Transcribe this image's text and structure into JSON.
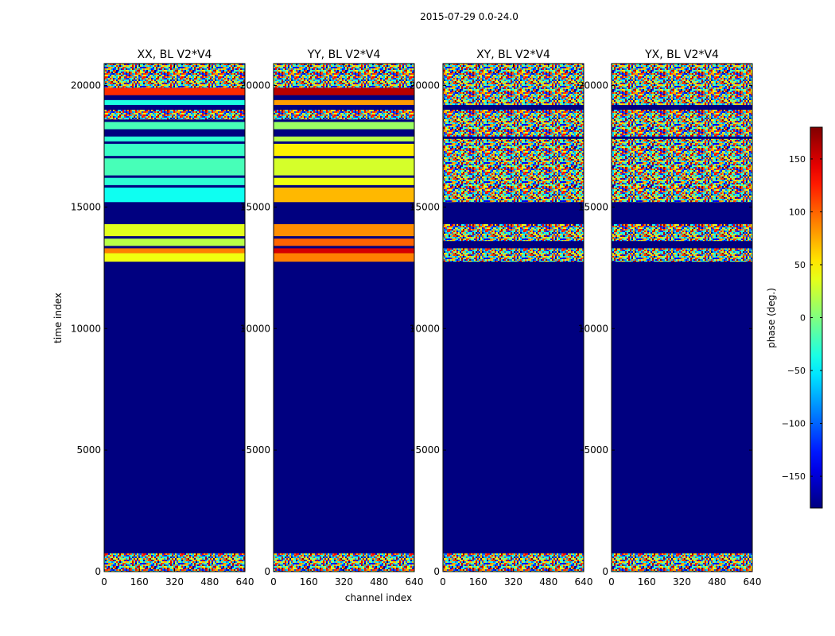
{
  "suptitle": "2015-07-29 0.0-24.0",
  "chart_data": {
    "type": "heatmap",
    "xlabel": "channel index",
    "ylabel": "time index",
    "xlim": [
      0,
      640
    ],
    "ylim": [
      0,
      20900
    ],
    "xticks": [
      0,
      160,
      320,
      480,
      640
    ],
    "yticks": [
      0,
      5000,
      10000,
      15000,
      20000
    ],
    "colorbar": {
      "label": "phase (deg.)",
      "range": [
        -180,
        180
      ],
      "ticks": [
        150,
        100,
        50,
        0,
        -50,
        -100,
        -150
      ],
      "colormap": "jet"
    },
    "panels": [
      {
        "title": "XX, BL V2*V4",
        "bands": [
          {
            "t0": 0,
            "t1": 750,
            "phase": "noise"
          },
          {
            "t0": 750,
            "t1": 12750,
            "phase": -180
          },
          {
            "t0": 12750,
            "t1": 13100,
            "phase": 40
          },
          {
            "t0": 13100,
            "t1": 13300,
            "phase": 90
          },
          {
            "t0": 13400,
            "t1": 13700,
            "phase": 20
          },
          {
            "t0": 13800,
            "t1": 14300,
            "phase": 35
          },
          {
            "t0": 14300,
            "t1": 15100,
            "phase": -180
          },
          {
            "t0": 15200,
            "t1": 15800,
            "phase": -40
          },
          {
            "t0": 15900,
            "t1": 16200,
            "phase": -30
          },
          {
            "t0": 16300,
            "t1": 17000,
            "phase": -20
          },
          {
            "t0": 17100,
            "t1": 17600,
            "phase": -25
          },
          {
            "t0": 17700,
            "t1": 17900,
            "phase": -30
          },
          {
            "t0": 18200,
            "t1": 18500,
            "phase": -20
          },
          {
            "t0": 18600,
            "t1": 19000,
            "phase": "noise"
          },
          {
            "t0": 19200,
            "t1": 19400,
            "phase": -35
          },
          {
            "t0": 19600,
            "t1": 19900,
            "phase": 120
          },
          {
            "t0": 19900,
            "t1": 20900,
            "phase": "noise"
          }
        ]
      },
      {
        "title": "YY, BL V2*V4",
        "bands": [
          {
            "t0": 0,
            "t1": 750,
            "phase": "noise"
          },
          {
            "t0": 750,
            "t1": 12750,
            "phase": -180
          },
          {
            "t0": 12750,
            "t1": 13100,
            "phase": 90
          },
          {
            "t0": 13100,
            "t1": 13300,
            "phase": 150
          },
          {
            "t0": 13400,
            "t1": 13700,
            "phase": 100
          },
          {
            "t0": 13800,
            "t1": 14300,
            "phase": 85
          },
          {
            "t0": 14300,
            "t1": 15100,
            "phase": -180
          },
          {
            "t0": 15200,
            "t1": 15800,
            "phase": 70
          },
          {
            "t0": 15900,
            "t1": 16200,
            "phase": 40
          },
          {
            "t0": 16300,
            "t1": 17000,
            "phase": 30
          },
          {
            "t0": 17100,
            "t1": 17600,
            "phase": 50
          },
          {
            "t0": 17700,
            "t1": 17900,
            "phase": 20
          },
          {
            "t0": 18200,
            "t1": 18500,
            "phase": 10
          },
          {
            "t0": 18600,
            "t1": 19000,
            "phase": "noise"
          },
          {
            "t0": 19200,
            "t1": 19400,
            "phase": 80
          },
          {
            "t0": 19600,
            "t1": 19900,
            "phase": 160
          },
          {
            "t0": 19900,
            "t1": 20900,
            "phase": "noise"
          }
        ]
      },
      {
        "title": "XY, BL V2*V4",
        "bands": [
          {
            "t0": 0,
            "t1": 750,
            "phase": "noise"
          },
          {
            "t0": 750,
            "t1": 12750,
            "phase": -180
          },
          {
            "t0": 12750,
            "t1": 13300,
            "phase": "noise"
          },
          {
            "t0": 13600,
            "t1": 14300,
            "phase": "noise"
          },
          {
            "t0": 14300,
            "t1": 15100,
            "phase": -180
          },
          {
            "t0": 15200,
            "t1": 17800,
            "phase": "noise"
          },
          {
            "t0": 17900,
            "t1": 19000,
            "phase": "noise"
          },
          {
            "t0": 19200,
            "t1": 20900,
            "phase": "noise"
          }
        ]
      },
      {
        "title": "YX, BL V2*V4",
        "bands": [
          {
            "t0": 0,
            "t1": 750,
            "phase": "noise"
          },
          {
            "t0": 750,
            "t1": 12750,
            "phase": -180
          },
          {
            "t0": 12750,
            "t1": 13300,
            "phase": "noise"
          },
          {
            "t0": 13600,
            "t1": 14300,
            "phase": "noise"
          },
          {
            "t0": 14300,
            "t1": 15100,
            "phase": -180
          },
          {
            "t0": 15200,
            "t1": 17800,
            "phase": "noise"
          },
          {
            "t0": 17900,
            "t1": 19000,
            "phase": "noise"
          },
          {
            "t0": 19200,
            "t1": 20900,
            "phase": "noise"
          }
        ]
      }
    ]
  }
}
